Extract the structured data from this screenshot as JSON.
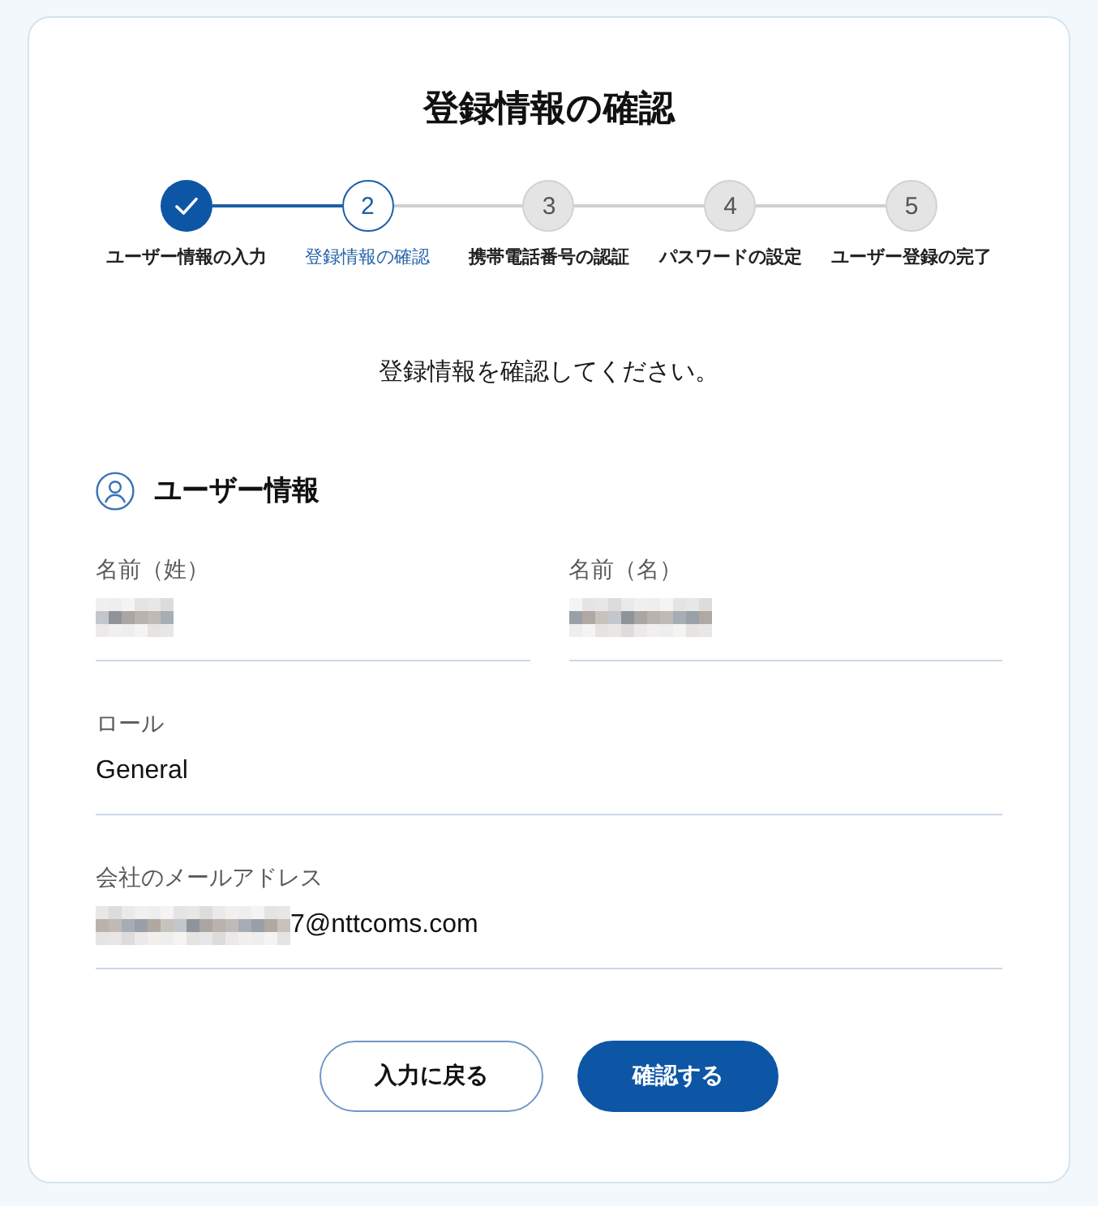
{
  "page": {
    "title": "登録情報の確認"
  },
  "steps": [
    {
      "label": "ユーザー情報の入力",
      "completed": true,
      "selected": false
    },
    {
      "number": "2",
      "label": "登録情報の確認",
      "completed": false,
      "selected": true
    },
    {
      "number": "3",
      "label": "携帯電話番号の認証",
      "completed": false,
      "selected": false
    },
    {
      "number": "4",
      "label": "パスワードの設定",
      "completed": false,
      "selected": false
    },
    {
      "number": "5",
      "label": "ユーザー登録の完了",
      "completed": false,
      "selected": false
    }
  ],
  "instruction": "登録情報を確認してください。",
  "section": {
    "title": "ユーザー情報"
  },
  "field_rows": [
    [
      {
        "label": "名前（姓）",
        "redacted": true
      },
      {
        "label": "名前（名）",
        "redacted": true
      }
    ],
    [
      {
        "label": "ロール",
        "value": "General",
        "redacted": false
      }
    ],
    [
      {
        "label": "会社のメールアドレス",
        "value": "7@nttcoms.com",
        "redacted": true
      }
    ]
  ],
  "buttons": [
    {
      "label": "入力に戻る",
      "kind": "secondary"
    },
    {
      "label": "確認する",
      "kind": "primary"
    }
  ]
}
